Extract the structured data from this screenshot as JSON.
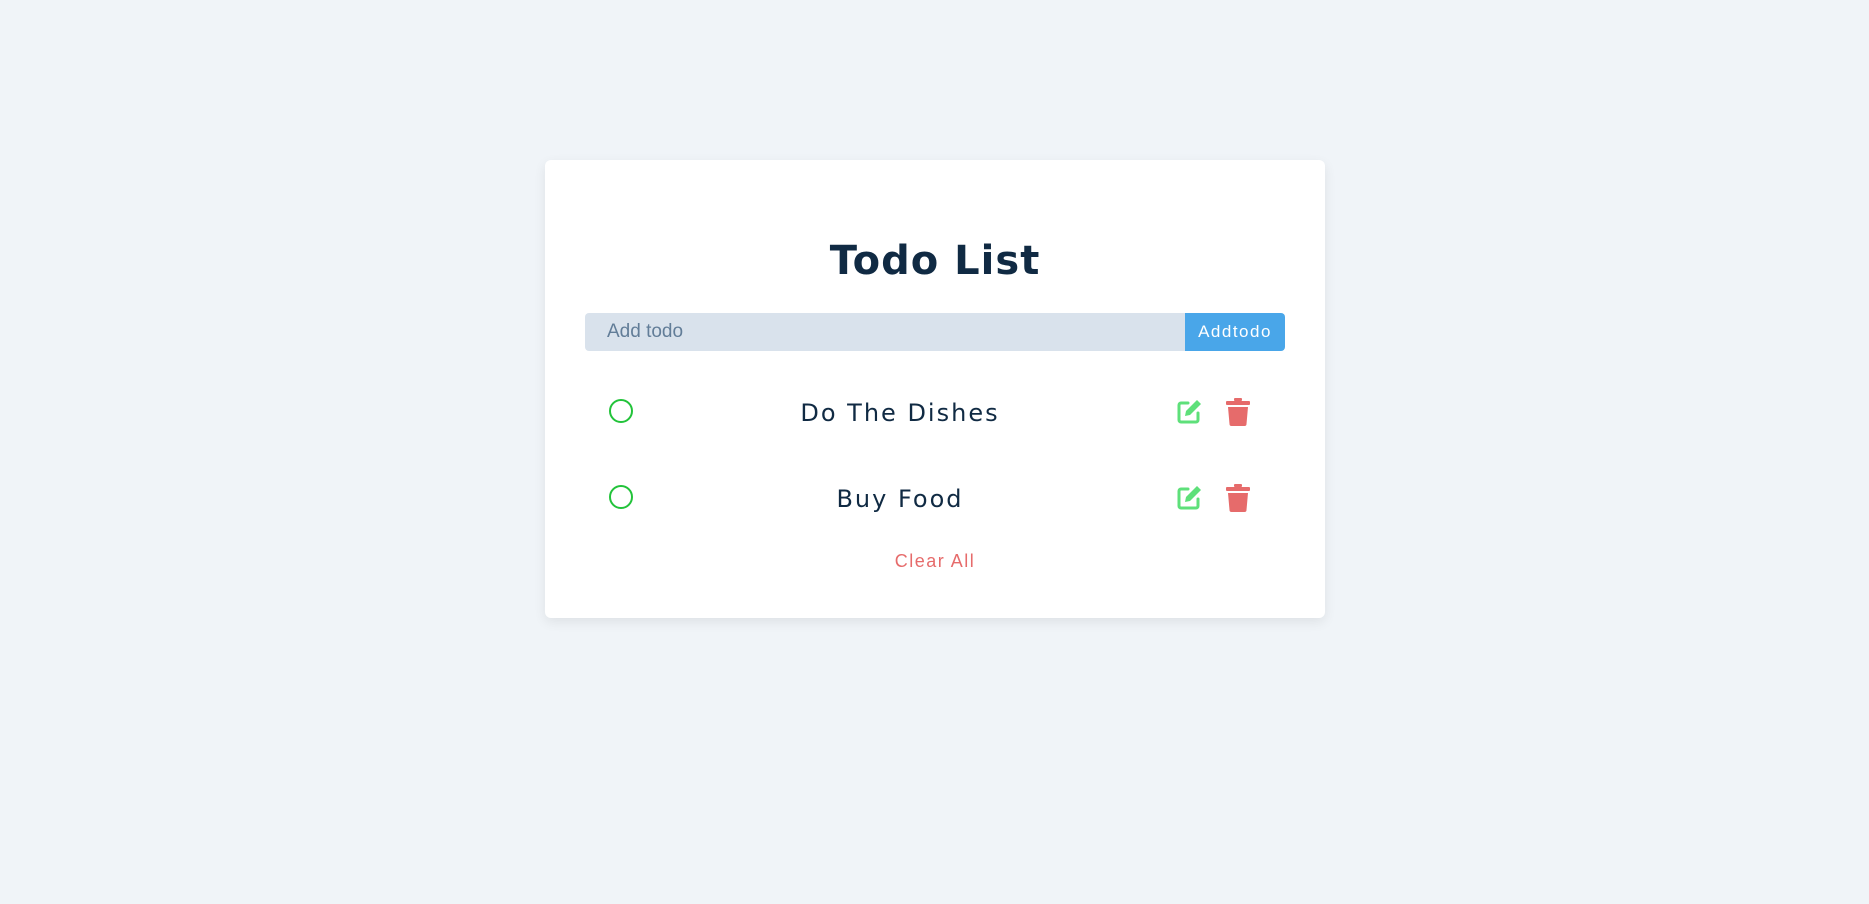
{
  "app": {
    "title": "Todo List"
  },
  "form": {
    "placeholder": "Add todo",
    "value": "",
    "submit_label": "Addtodo"
  },
  "todos": [
    {
      "text": "Do The Dishes",
      "completed": false
    },
    {
      "text": "Buy Food",
      "completed": false
    }
  ],
  "actions": {
    "clear_all_label": "Clear All"
  },
  "icons": {
    "complete": "circle-outline-icon",
    "edit": "edit-icon",
    "delete": "trash-icon"
  },
  "colors": {
    "background": "#f0f4f8",
    "card": "#ffffff",
    "title": "#102a43",
    "input_bg": "#d9e2ec",
    "accent": "#49a6e9",
    "check": "#22c33a",
    "edit": "#5ee07a",
    "delete": "#e66b6b"
  }
}
